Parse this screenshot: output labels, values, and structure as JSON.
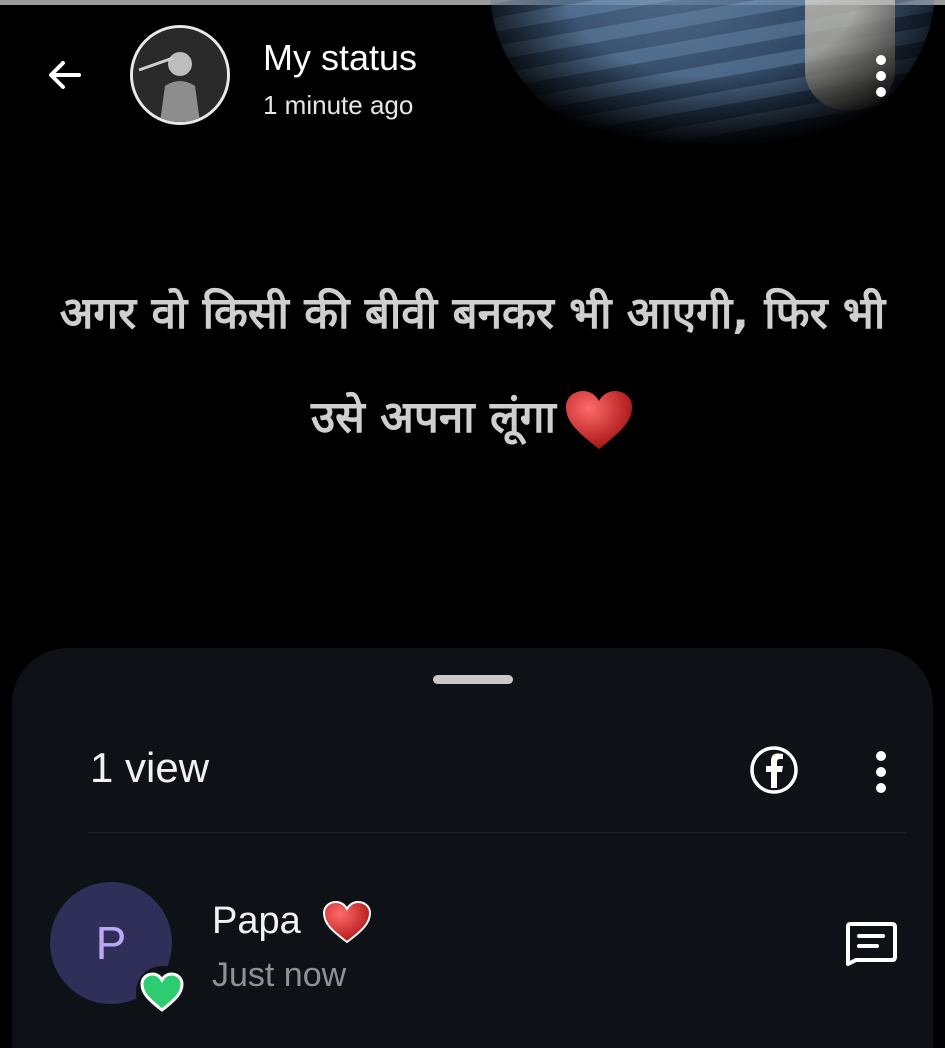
{
  "header": {
    "title": "My status",
    "subtitle": "1 minute ago"
  },
  "status": {
    "text": "अगर वो किसी की बीवी बनकर भी आएगी, फिर भी उसे अपना लूंगा"
  },
  "sheet": {
    "views_label": "1 view"
  },
  "viewers": [
    {
      "initial": "P",
      "name": "Papa",
      "time": "Just now"
    }
  ],
  "colors": {
    "background": "#000000",
    "sheet": "#0e1216",
    "reaction_heart": "#d42a2a",
    "reaction_badge": "#2ecc71",
    "avatar_bg": "#2f2f5a",
    "avatar_letter": "#b9a8f5"
  },
  "icons": {
    "back": "arrow-left-icon",
    "menu": "more-vertical-icon",
    "share": "facebook-icon",
    "message": "message-icon",
    "reaction": "heart-icon"
  }
}
